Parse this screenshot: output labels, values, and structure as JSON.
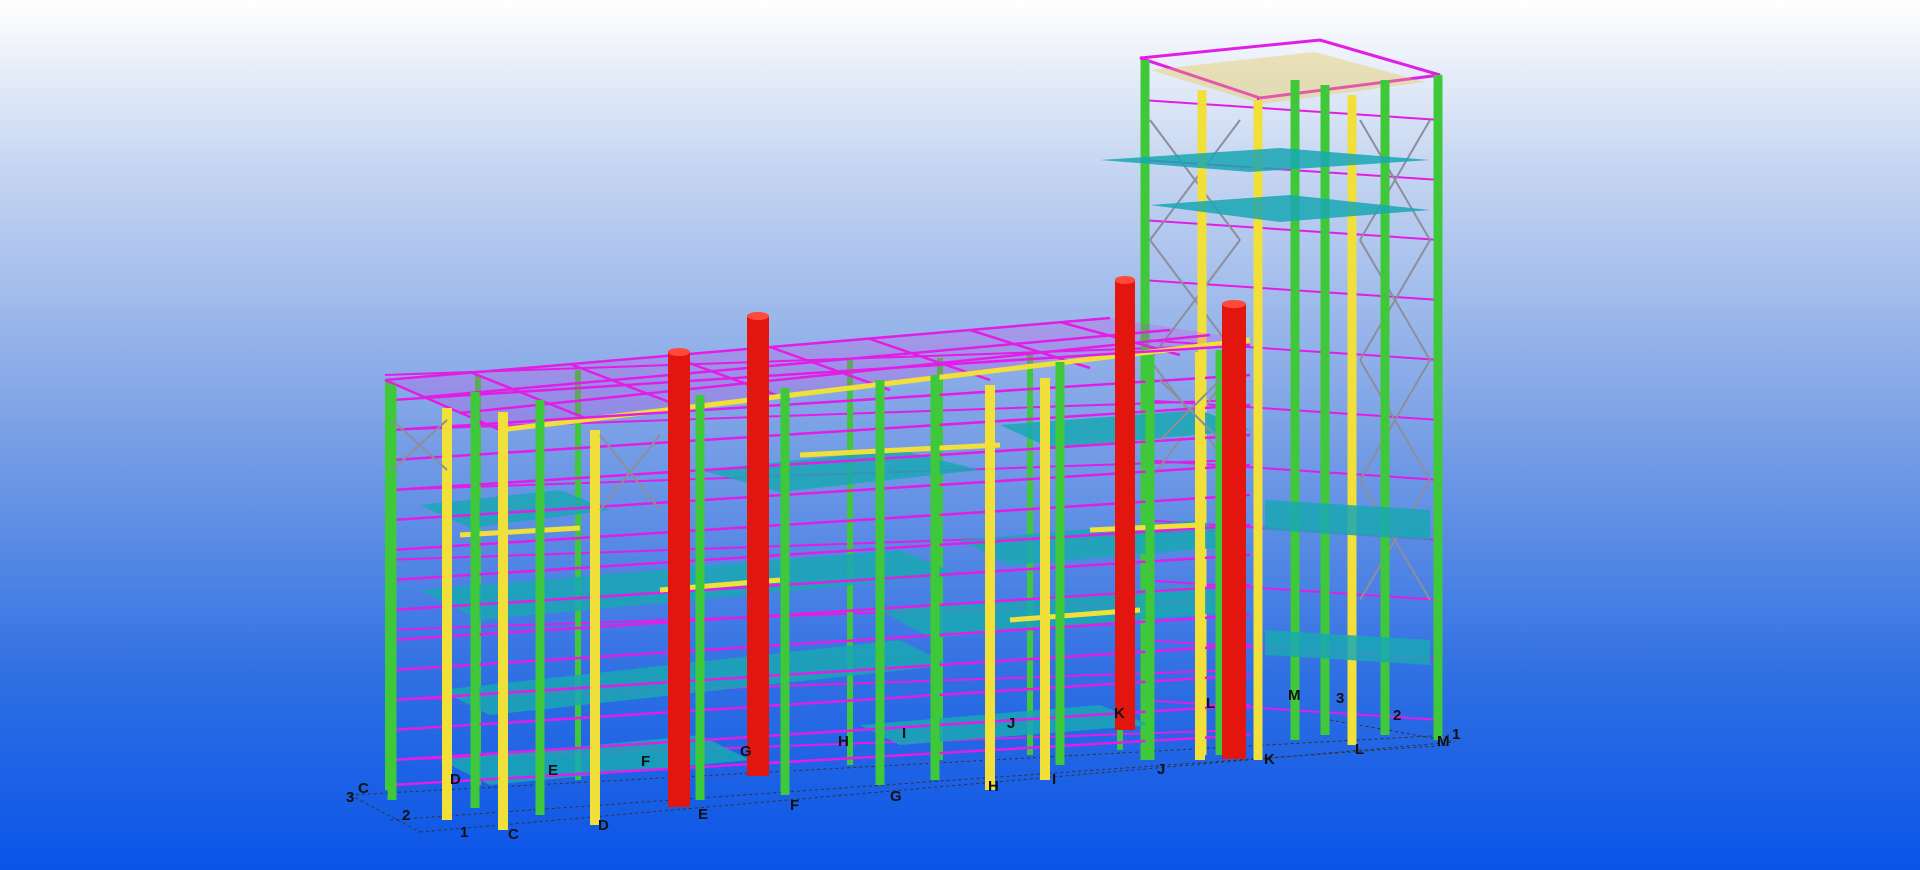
{
  "viewport": {
    "background_top": "#ffffff",
    "background_bottom": "#0a55e8"
  },
  "colors": {
    "column_green": "#3fc93a",
    "column_yellow": "#f2e03a",
    "beam_magenta": "#e21ee6",
    "floor_teal": "#1aa7b4",
    "vessel_red": "#e3150f",
    "brace_grey": "#8d8d9c",
    "label_text": "#111111"
  },
  "grid_labels": {
    "front_C": "C",
    "front_D": "D",
    "front_E": "E",
    "front_F": "F",
    "front_G": "G",
    "front_H": "H",
    "front_I": "I",
    "front_J": "J",
    "front_K": "K",
    "front_L": "L",
    "front_M": "M",
    "front_1": "1",
    "back_C": "C",
    "back_D": "D",
    "back_E": "E",
    "back_F": "F",
    "back_G": "G",
    "back_H": "H",
    "back_I": "I",
    "back_J": "J",
    "back_K": "K",
    "back_L": "L",
    "back_M": "M",
    "left_3": "3",
    "left_2": "2",
    "left_1": "1",
    "right_3": "3",
    "right_2": "2"
  }
}
